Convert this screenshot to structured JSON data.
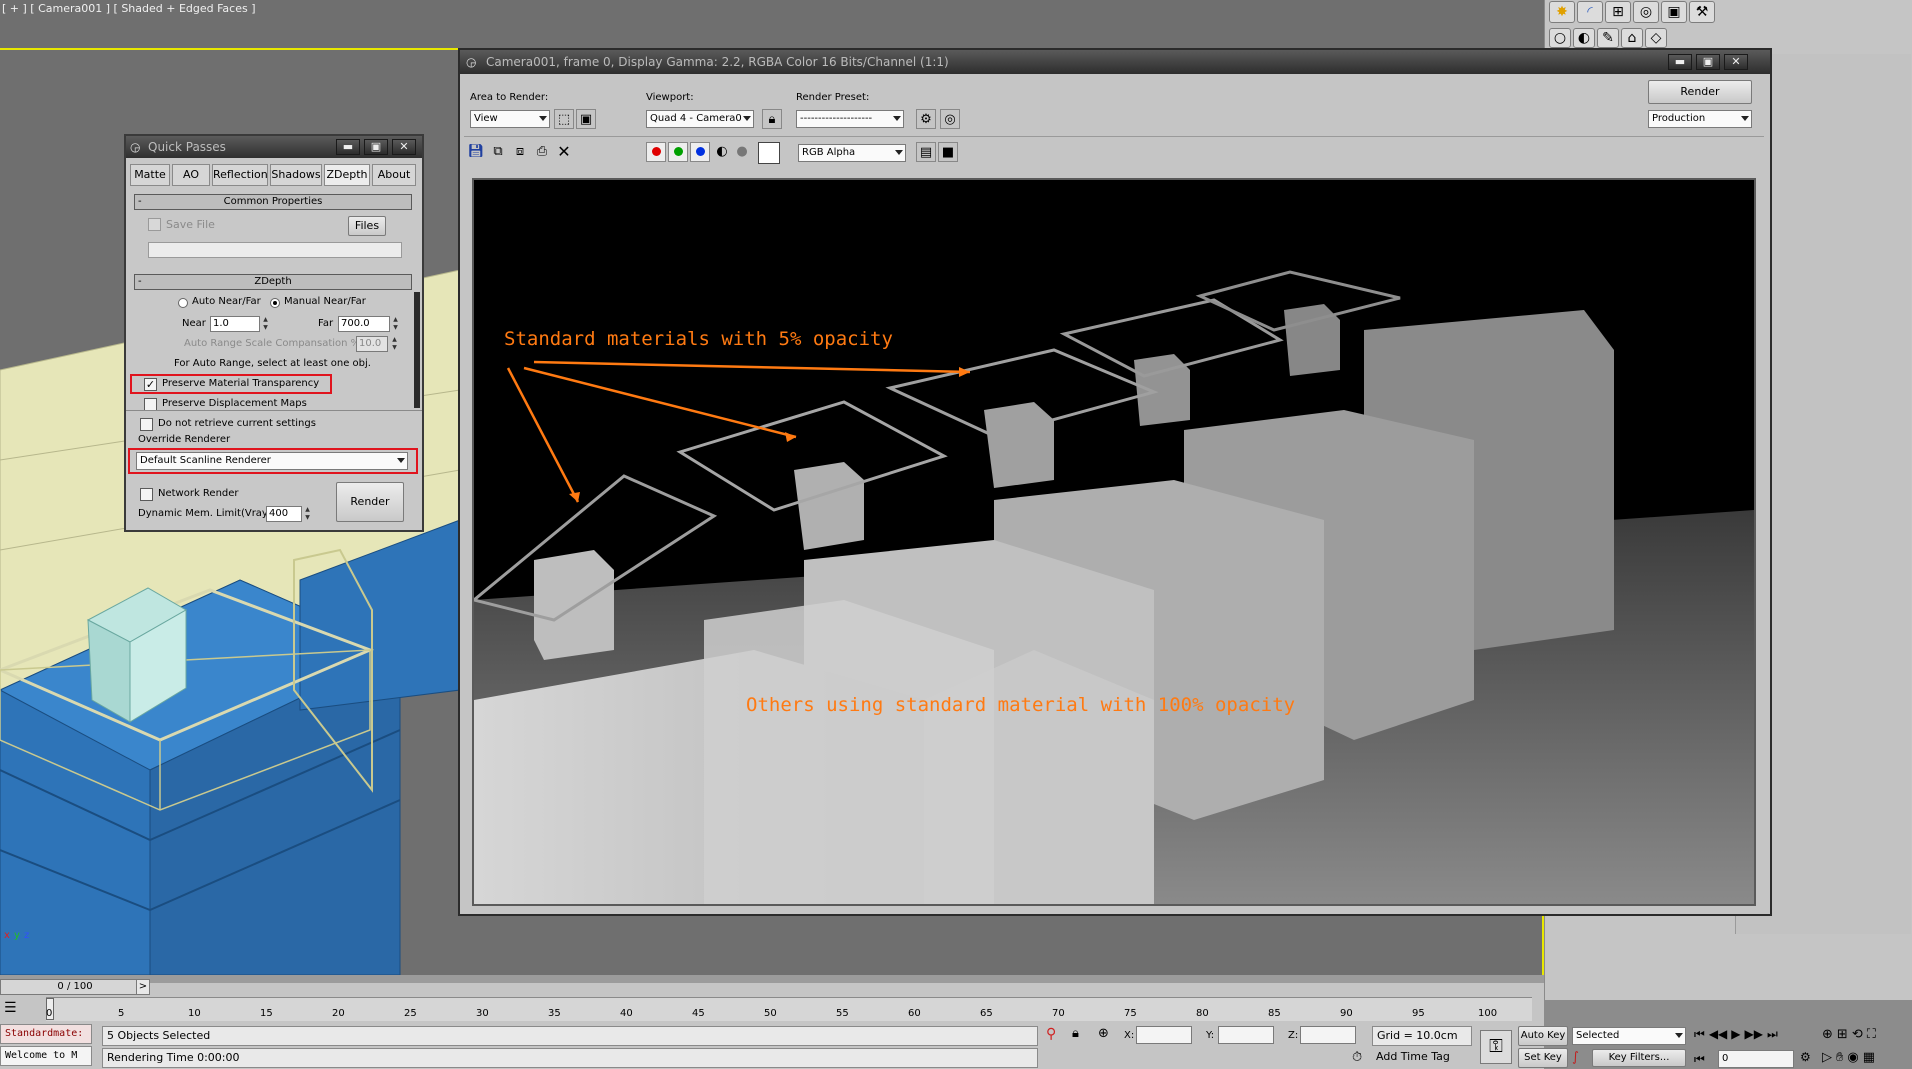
{
  "viewport": {
    "label": "[ + ] [ Camera001 ] [ Shaded + Edged Faces ]",
    "axis_x": "x",
    "axis_y": "y",
    "axis_z": "z"
  },
  "quick_passes": {
    "title": "Quick Passes",
    "tabs": [
      "Matte",
      "AO",
      "Reflection",
      "Shadows",
      "ZDepth",
      "About"
    ],
    "common_title": "Common Properties",
    "save_file_label": "Save File",
    "files_button": "Files",
    "zdepth_title": "ZDepth",
    "auto_near_far": "Auto Near/Far",
    "manual_near_far": "Manual Near/Far",
    "near_label": "Near",
    "near_value": "1.0",
    "far_label": "Far",
    "far_value": "700.0",
    "auto_range_label": "Auto Range Scale Compansation %",
    "auto_range_value": "10.0",
    "auto_range_hint": "For Auto Range, select at least one obj.",
    "preserve_transparency": "Preserve Material Transparency",
    "preserve_displacement": "Preserve Displacement Maps",
    "do_not_retrieve": "Do not retrieve current settings",
    "override_renderer_label": "Override Renderer",
    "override_renderer_value": "Default Scanline Renderer",
    "network_render": "Network Render",
    "dynamic_mem_label": "Dynamic Mem. Limit(Vray)",
    "dynamic_mem_value": "400",
    "render_button": "Render",
    "min_icon": "▬",
    "max_icon": "▣",
    "close_icon": "✕",
    "collapse_symbol": "-"
  },
  "render_frame": {
    "title": "Camera001, frame 0, Display Gamma: 2.2, RGBA Color 16 Bits/Channel (1:1)",
    "area_to_render_label": "Area to Render:",
    "area_to_render_value": "View",
    "viewport_label": "Viewport:",
    "viewport_value": "Quad 4 - Camera0",
    "render_preset_label": "Render Preset:",
    "render_preset_value": "--------------------",
    "render_button": "Render",
    "production_value": "Production",
    "channel_value": "RGB Alpha",
    "annotation_1": "Standard materials with 5% opacity",
    "annotation_2": "Others using standard material with 100% opacity",
    "accent_orange": "#ff7a12"
  },
  "timeline": {
    "frame_counter": "0 / 100",
    "ticks": [
      "0",
      "5",
      "10",
      "15",
      "20",
      "25",
      "30",
      "35",
      "40",
      "45",
      "50",
      "55",
      "60",
      "65",
      "70",
      "75",
      "80",
      "85",
      "90",
      "95",
      "100"
    ]
  },
  "status_bar": {
    "script_line": "Standardmate:",
    "welcome": "Welcome to M",
    "selection": "5 Objects Selected",
    "rendering_time": "Rendering Time  0:00:00",
    "x_label": "X:",
    "y_label": "Y:",
    "z_label": "Z:",
    "grid": "Grid = 10.0cm",
    "add_time_tag": "Add Time Tag",
    "auto_key": "Auto Key",
    "set_key": "Set Key",
    "selected_dropdown": "Selected",
    "key_filters": "Key Filters...",
    "frame_field": "0"
  }
}
